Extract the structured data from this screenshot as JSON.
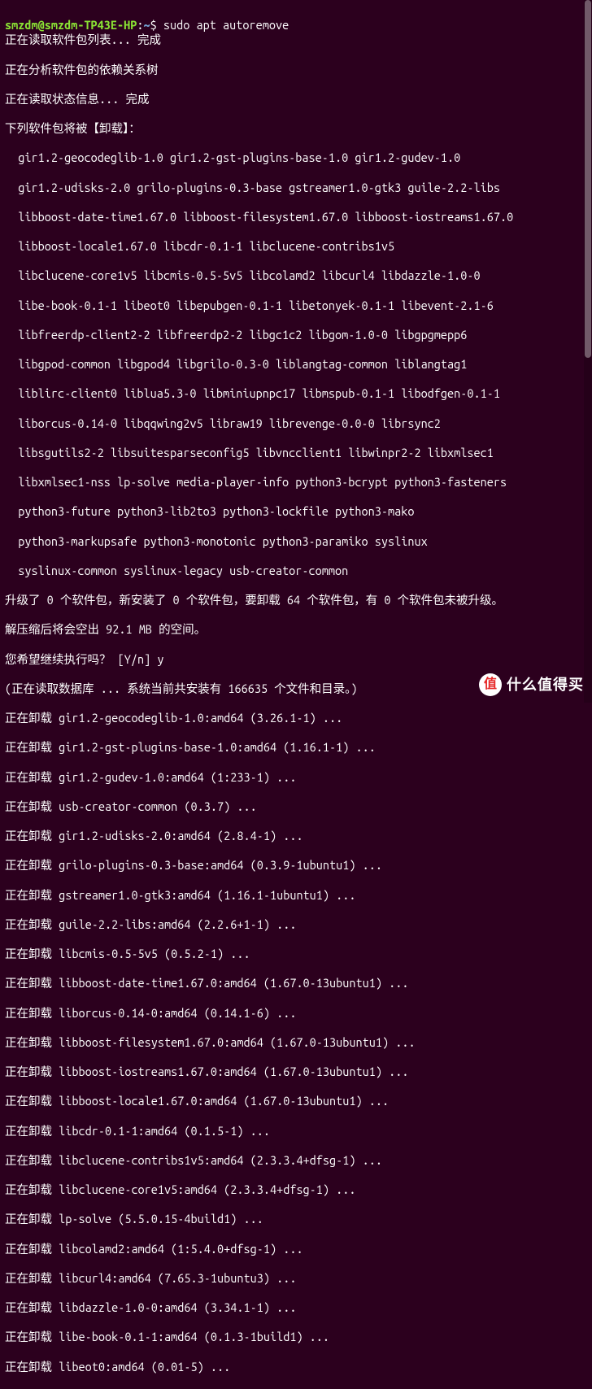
{
  "prompt": {
    "user_host": "smzdm@smzdm-TP43E-HP",
    "sep": ":",
    "path": "~",
    "dollar": "$",
    "command": "sudo apt autoremove"
  },
  "output": [
    "正在读取软件包列表... 完成",
    "正在分析软件包的依赖关系树",
    "正在读取状态信息... 完成",
    "下列软件包将被【卸载】：",
    "  gir1.2-geocodeglib-1.0 gir1.2-gst-plugins-base-1.0 gir1.2-gudev-1.0",
    "  gir1.2-udisks-2.0 grilo-plugins-0.3-base gstreamer1.0-gtk3 guile-2.2-libs",
    "  libboost-date-time1.67.0 libboost-filesystem1.67.0 libboost-iostreams1.67.0",
    "  libboost-locale1.67.0 libcdr-0.1-1 libclucene-contribs1v5",
    "  libclucene-core1v5 libcmis-0.5-5v5 libcolamd2 libcurl4 libdazzle-1.0-0",
    "  libe-book-0.1-1 libeot0 libepubgen-0.1-1 libetonyek-0.1-1 libevent-2.1-6",
    "  libfreerdp-client2-2 libfreerdp2-2 libgc1c2 libgom-1.0-0 libgpgmepp6",
    "  libgpod-common libgpod4 libgrilo-0.3-0 liblangtag-common liblangtag1",
    "  liblirc-client0 liblua5.3-0 libminiupnpc17 libmspub-0.1-1 libodfgen-0.1-1",
    "  liborcus-0.14-0 libqqwing2v5 libraw19 librevenge-0.0-0 librsync2",
    "  libsgutils2-2 libsuitesparseconfig5 libvncclient1 libwinpr2-2 libxmlsec1",
    "  libxmlsec1-nss lp-solve media-player-info python3-bcrypt python3-fasteners",
    "  python3-future python3-lib2to3 python3-lockfile python3-mako",
    "  python3-markupsafe python3-monotonic python3-paramiko syslinux",
    "  syslinux-common syslinux-legacy usb-creator-common",
    "升级了 0 个软件包，新安装了 0 个软件包，要卸载 64 个软件包，有 0 个软件包未被升级。",
    "解压缩后将会空出 92.1 MB 的空间。",
    "您希望继续执行吗？ [Y/n] y",
    "(正在读取数据库 ... 系统当前共安装有 166635 个文件和目录。)",
    "正在卸载 gir1.2-geocodeglib-1.0:amd64 (3.26.1-1) ...",
    "正在卸载 gir1.2-gst-plugins-base-1.0:amd64 (1.16.1-1) ...",
    "正在卸载 gir1.2-gudev-1.0:amd64 (1:233-1) ...",
    "正在卸载 usb-creator-common (0.3.7) ...",
    "正在卸载 gir1.2-udisks-2.0:amd64 (2.8.4-1) ...",
    "正在卸载 grilo-plugins-0.3-base:amd64 (0.3.9-1ubuntu1) ...",
    "正在卸载 gstreamer1.0-gtk3:amd64 (1.16.1-1ubuntu1) ...",
    "正在卸载 guile-2.2-libs:amd64 (2.2.6+1-1) ...",
    "正在卸载 libcmis-0.5-5v5 (0.5.2-1) ...",
    "正在卸载 libboost-date-time1.67.0:amd64 (1.67.0-13ubuntu1) ...",
    "正在卸载 liborcus-0.14-0:amd64 (0.14.1-6) ...",
    "正在卸载 libboost-filesystem1.67.0:amd64 (1.67.0-13ubuntu1) ...",
    "正在卸载 libboost-iostreams1.67.0:amd64 (1.67.0-13ubuntu1) ...",
    "正在卸载 libboost-locale1.67.0:amd64 (1.67.0-13ubuntu1) ...",
    "正在卸载 libcdr-0.1-1:amd64 (0.1.5-1) ...",
    "正在卸载 libclucene-contribs1v5:amd64 (2.3.3.4+dfsg-1) ...",
    "正在卸载 libclucene-core1v5:amd64 (2.3.3.4+dfsg-1) ...",
    "正在卸载 lp-solve (5.5.0.15-4build1) ...",
    "正在卸载 libcolamd2:amd64 (1:5.4.0+dfsg-1) ...",
    "正在卸载 libcurl4:amd64 (7.65.3-1ubuntu3) ...",
    "正在卸载 libdazzle-1.0-0:amd64 (3.34.1-1) ...",
    "正在卸载 libe-book-0.1-1:amd64 (0.1.3-1build1) ...",
    "正在卸载 libeot0:amd64 (0.01-5) ..."
  ],
  "watermark": {
    "badge": "值",
    "text": "什么值得买"
  }
}
